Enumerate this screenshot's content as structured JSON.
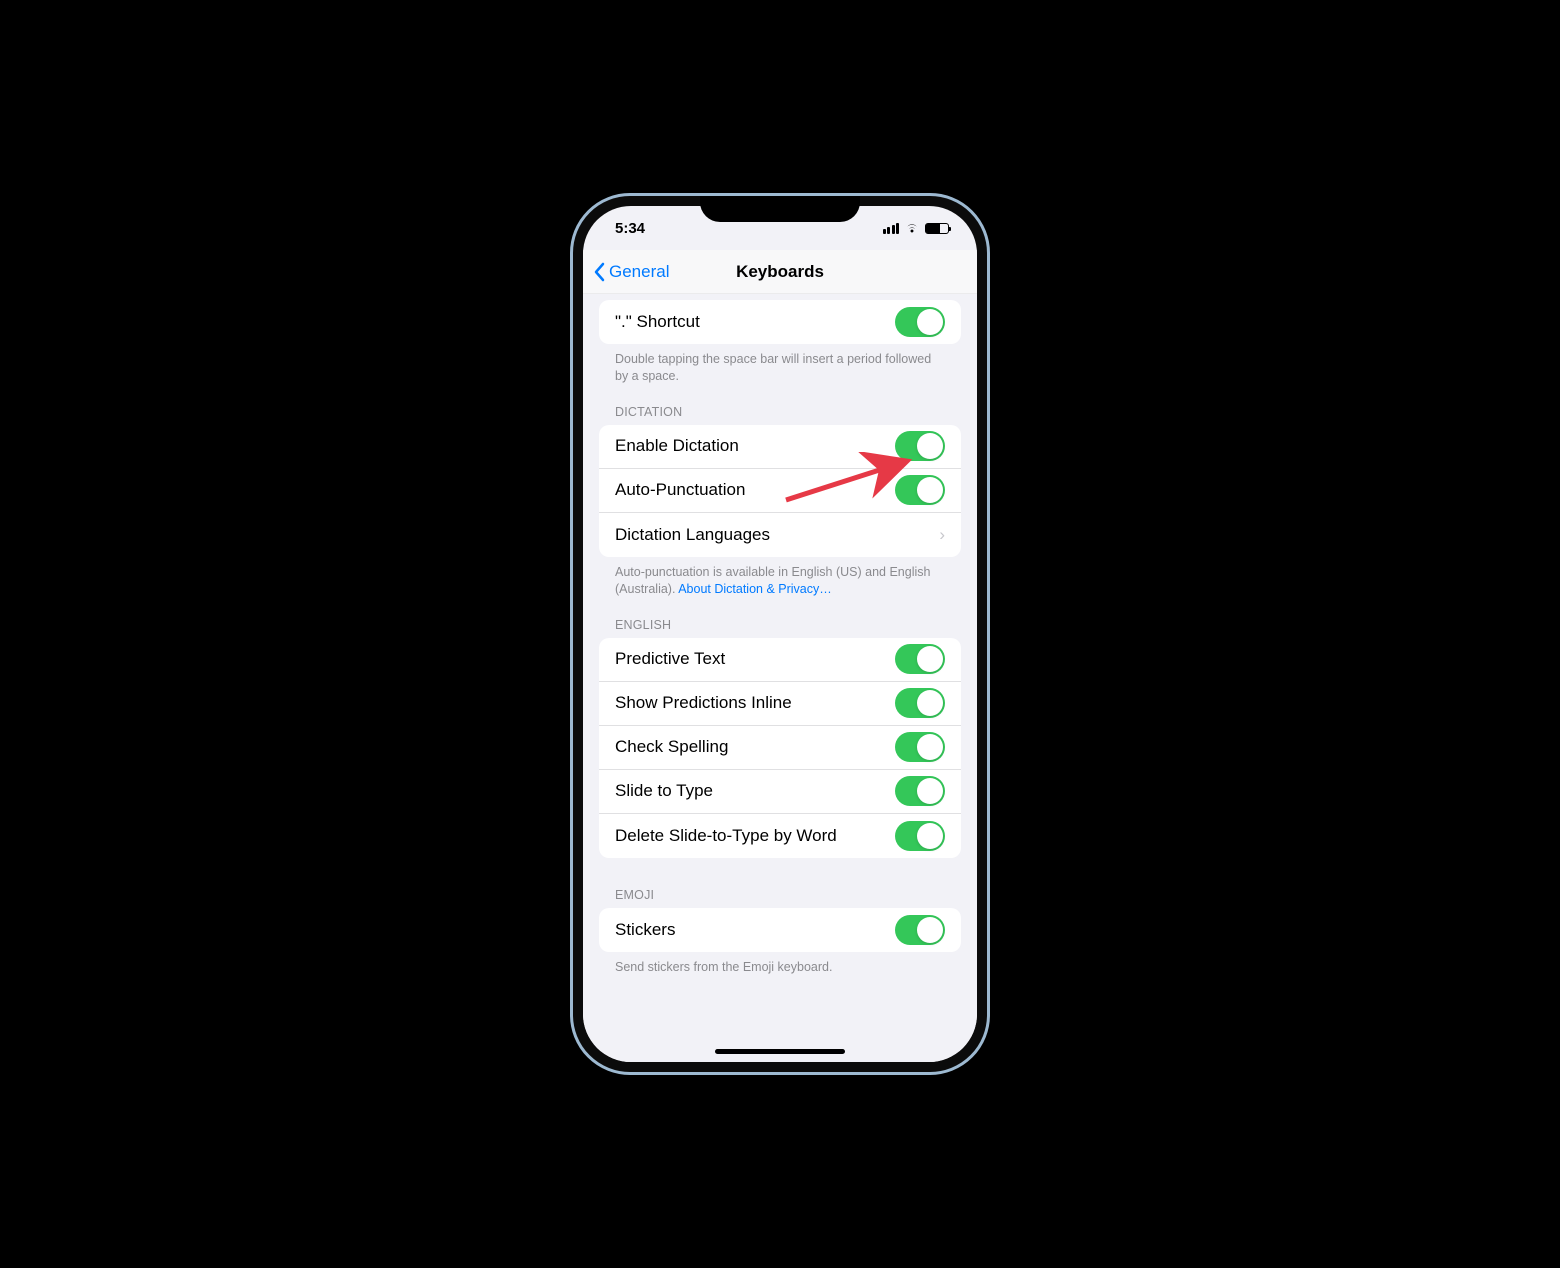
{
  "status": {
    "time": "5:34"
  },
  "nav": {
    "back_label": "General",
    "title": "Keyboards"
  },
  "shortcut": {
    "label": "\".\" Shortcut",
    "enabled": true,
    "footer": "Double tapping the space bar will insert a period followed by a space."
  },
  "dictation": {
    "header": "DICTATION",
    "rows": {
      "enable": {
        "label": "Enable Dictation",
        "enabled": true
      },
      "auto_punct": {
        "label": "Auto-Punctuation",
        "enabled": true
      },
      "languages": {
        "label": "Dictation Languages"
      }
    },
    "footer_text": "Auto-punctuation is available in English (US) and English (Australia). ",
    "footer_link": "About Dictation & Privacy…"
  },
  "english": {
    "header": "ENGLISH",
    "rows": [
      {
        "label": "Predictive Text",
        "enabled": true
      },
      {
        "label": "Show Predictions Inline",
        "enabled": true
      },
      {
        "label": "Check Spelling",
        "enabled": true
      },
      {
        "label": "Slide to Type",
        "enabled": true
      },
      {
        "label": "Delete Slide-to-Type by Word",
        "enabled": true
      }
    ]
  },
  "emoji": {
    "header": "EMOJI",
    "stickers": {
      "label": "Stickers",
      "enabled": true
    },
    "footer": "Send stickers from the Emoji keyboard."
  }
}
